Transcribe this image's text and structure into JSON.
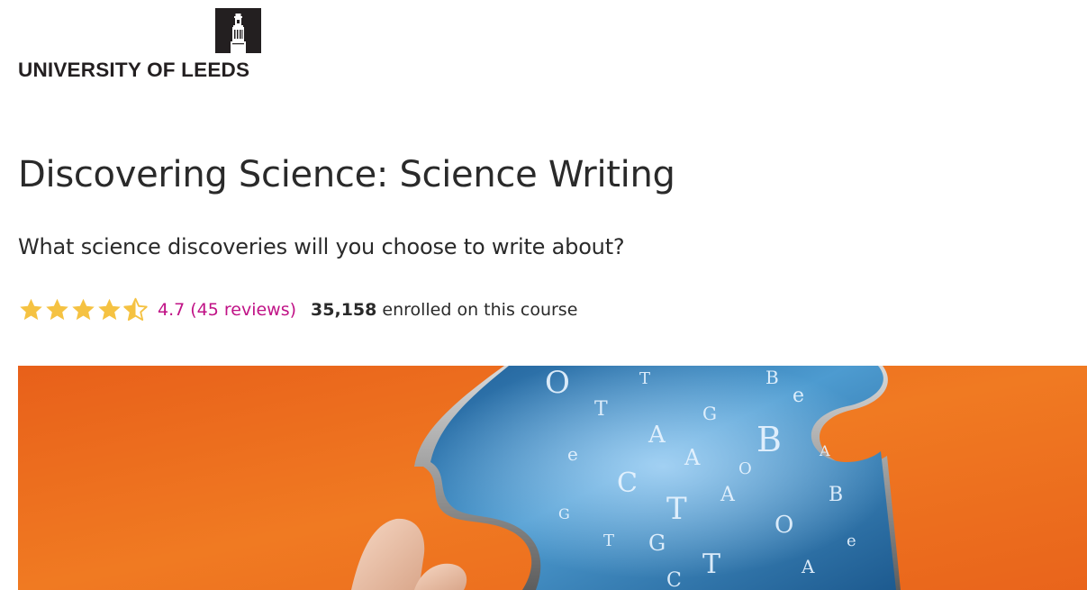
{
  "university": {
    "name": "UNIVERSITY OF LEEDS",
    "logo_icon": "leeds-tower-icon"
  },
  "course": {
    "title": "Discovering Science: Science Writing",
    "subtitle": "What science discoveries will you choose to write about?"
  },
  "rating": {
    "value": 4.7,
    "max": 5,
    "label": "4.7 (45 reviews)",
    "enrolled_count": "35,158",
    "enrolled_text": "enrolled on this course"
  },
  "hero": {
    "description_icon": "puzzle-piece-letters-image",
    "letters": [
      "O",
      "T",
      "A",
      "G",
      "B",
      "e",
      "C",
      "T",
      "A",
      "O",
      "G",
      "T",
      "e",
      "B",
      "A",
      "T",
      "O",
      "A",
      "G",
      "e",
      "T",
      "B",
      "C",
      "A"
    ]
  },
  "colors": {
    "brand_text": "#231f20",
    "accent_magenta": "#c01286",
    "star_gold": "#f5c242",
    "hero_orange": "#ee6d1a",
    "puzzle_blue": "#3f8cc4"
  }
}
